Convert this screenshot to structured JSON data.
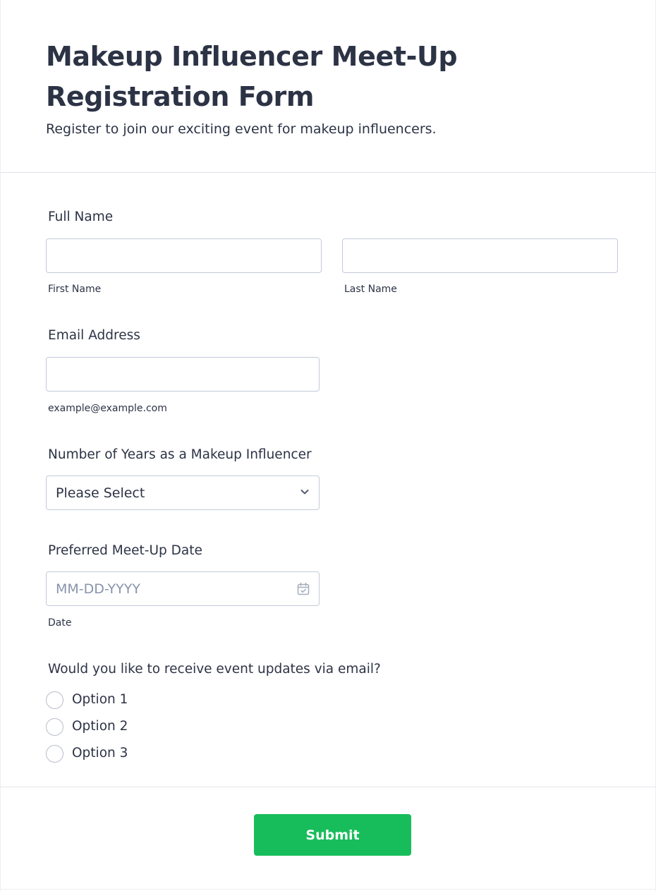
{
  "header": {
    "title": "Makeup Influencer Meet-Up Registration Form",
    "subtitle": "Register to join our exciting event for makeup influencers."
  },
  "full_name": {
    "label": "Full Name",
    "first_name_value": "",
    "first_name_sublabel": "First Name",
    "last_name_value": "",
    "last_name_sublabel": "Last Name"
  },
  "email": {
    "label": "Email Address",
    "value": "",
    "sublabel": "example@example.com"
  },
  "years": {
    "label": "Number of Years as a Makeup Influencer",
    "selected": "Please Select",
    "icon": "chevron-down-icon"
  },
  "date": {
    "label": "Preferred Meet-Up Date",
    "placeholder": "MM-DD-YYYY",
    "sublabel": "Date",
    "icon": "calendar-icon"
  },
  "updates": {
    "label": "Would you like to receive event updates via email?",
    "options": [
      {
        "label": "Option 1",
        "checked": false
      },
      {
        "label": "Option 2",
        "checked": false
      },
      {
        "label": "Option 3",
        "checked": false
      }
    ]
  },
  "submit": {
    "label": "Submit",
    "color": "#18bd5b"
  }
}
